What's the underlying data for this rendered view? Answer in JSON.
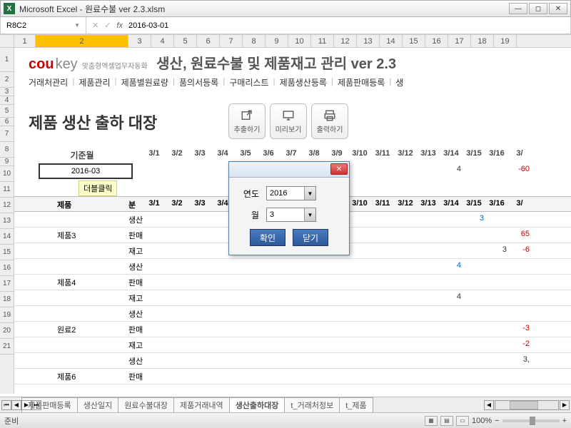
{
  "window": {
    "title": "Microsoft Excel - 원료수불 ver 2.3.xlsm"
  },
  "namebox": "R8C2",
  "formula": "2016-03-01",
  "col_headers": [
    "1",
    "2",
    "3",
    "4",
    "5",
    "6",
    "7",
    "8",
    "9",
    "10",
    "11",
    "12",
    "13",
    "14",
    "15",
    "16",
    "17",
    "18",
    "19"
  ],
  "row_headers": [
    "1",
    "2",
    "3",
    "4",
    "5",
    "6",
    "7",
    "8",
    "9",
    "10",
    "11",
    "12",
    "13",
    "14",
    "15",
    "16",
    "17",
    "18",
    "19",
    "20",
    "21"
  ],
  "logo": {
    "brand1": "cou",
    "brand2": "key",
    "tag": "맞춤형엑셀업무자동화"
  },
  "main_title": "생산, 원료수불 및 제품재고 관리 ver 2.3",
  "menu": [
    "거래처관리",
    "제품관리",
    "제품별원료량",
    "품의서등록",
    "구매리스트",
    "제품생산등록",
    "제품판매등록",
    "생"
  ],
  "section_title": "제품 생산 출하 대장",
  "toolbar": {
    "extract": "추출하기",
    "preview": "미리보기",
    "print": "출력하기"
  },
  "base_month_label": "기준월",
  "base_month_value": "2016-03",
  "tooltip": "더블클릭",
  "date_cols": [
    "3/1",
    "3/2",
    "3/3",
    "3/4",
    "3/5",
    "3/6",
    "3/7",
    "3/8",
    "3/9",
    "3/10",
    "3/11",
    "3/12",
    "3/13",
    "3/14",
    "3/15",
    "3/16",
    "3/"
  ],
  "product_col_label": "제품",
  "second_col_suffix": "분",
  "rows": [
    {
      "product": "",
      "cat": "생산",
      "vals": {}
    },
    {
      "product": "제품3",
      "cat": "판매",
      "vals": {}
    },
    {
      "product": "",
      "cat": "재고",
      "vals": {}
    },
    {
      "product": "",
      "cat": "생산",
      "vals": {}
    },
    {
      "product": "제품4",
      "cat": "판매",
      "vals": {}
    },
    {
      "product": "",
      "cat": "재고",
      "vals": {}
    },
    {
      "product": "",
      "cat": "생산",
      "vals": {}
    },
    {
      "product": "원료2",
      "cat": "판매",
      "vals": {}
    },
    {
      "product": "",
      "cat": "재고",
      "vals": {}
    },
    {
      "product": "",
      "cat": "생산",
      "vals": {}
    },
    {
      "product": "제품6",
      "cat": "판매",
      "vals": {}
    }
  ],
  "scattered": [
    {
      "r": 0,
      "c": 14,
      "v": "3",
      "color": "#06c"
    },
    {
      "r": 1,
      "c": 16,
      "v": "65",
      "color": "#c00"
    },
    {
      "r": 2,
      "c": 15,
      "v": "3",
      "color": "#333"
    },
    {
      "r": 2,
      "c": 16,
      "v": "-6",
      "color": "#c00"
    },
    {
      "r": 3,
      "c": 13,
      "v": "4",
      "color": "#06c"
    },
    {
      "r": 5,
      "c": 13,
      "v": "4",
      "color": "#333"
    },
    {
      "r": 7,
      "c": 16,
      "v": "-3",
      "color": "#c00"
    },
    {
      "r": 8,
      "c": 16,
      "v": "-2",
      "color": "#c00"
    },
    {
      "r": 9,
      "c": 16,
      "v": "3,",
      "color": "#333"
    }
  ],
  "top_right_vals": [
    {
      "c": 13,
      "v": "4"
    },
    {
      "c": 16,
      "v": "-60",
      "color": "#c00"
    }
  ],
  "dialog": {
    "year_label": "연도",
    "year_value": "2016",
    "month_label": "월",
    "month_value": "3",
    "ok": "확인",
    "close": "닫기"
  },
  "tabs": [
    "제품판매등록",
    "생산일지",
    "원료수불대장",
    "제품거래내역",
    "생산출하대장",
    "t_거래처정보",
    "t_제품"
  ],
  "active_tab": 4,
  "status": {
    "ready": "준비",
    "zoom": "100%"
  },
  "chart_data": {
    "type": "table",
    "title": "제품 생산 출하 대장",
    "categories": [],
    "values": []
  }
}
